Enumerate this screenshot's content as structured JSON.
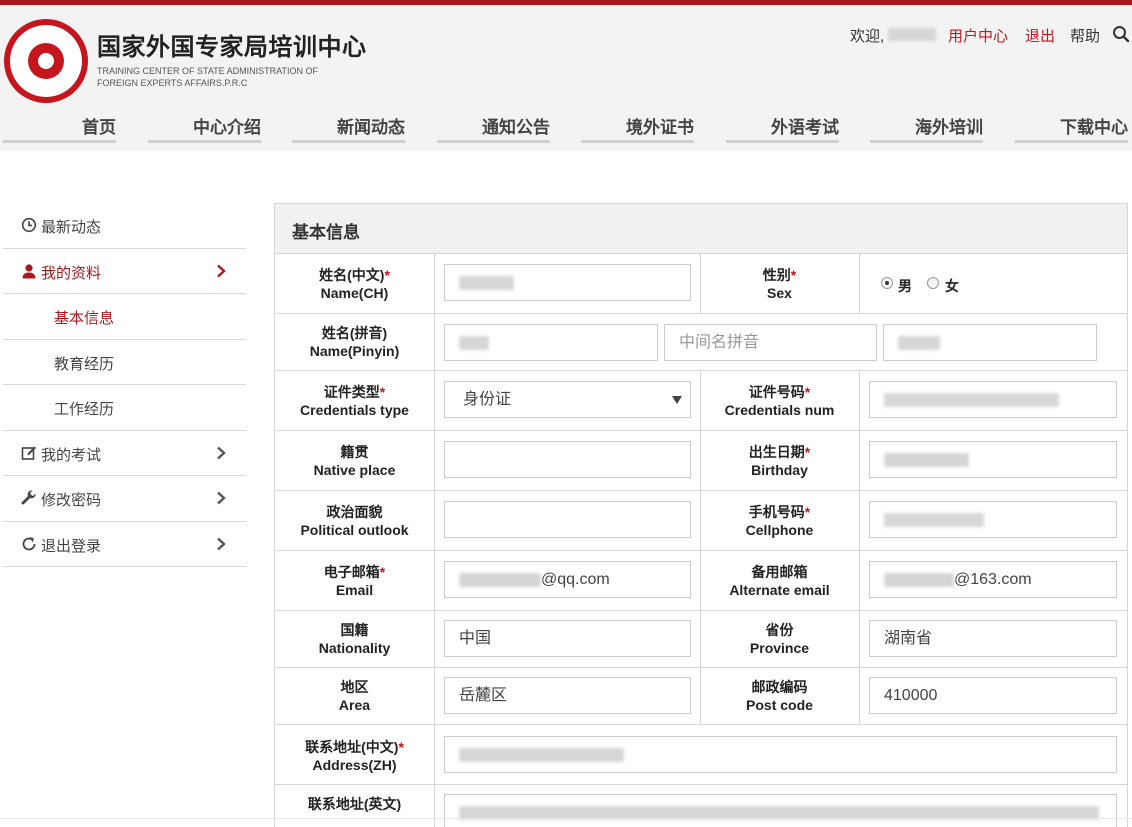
{
  "brand": {
    "logo_text": "国家外国专家局培训中心",
    "title": "国家外国专家局培训中心",
    "subtitle": "TRAINING CENTER OF STATE ADMINISTRATION OF FOREIGN EXPERTS AFFAIRS.P.R.C"
  },
  "userbar": {
    "welcome": "欢迎,",
    "user_center": "用户中心",
    "logout": "退出",
    "help": "帮助"
  },
  "nav": [
    "首页",
    "中心介绍",
    "新闻动态",
    "通知公告",
    "境外证书",
    "外语考试",
    "海外培训",
    "下载中心"
  ],
  "sidebar": {
    "items": [
      {
        "label": "最新动态",
        "icon": "clock-icon"
      },
      {
        "label": "我的资料",
        "icon": "user-icon"
      },
      {
        "label": "基本信息"
      },
      {
        "label": "教育经历"
      },
      {
        "label": "工作经历"
      },
      {
        "label": "我的考试",
        "icon": "edit-icon"
      },
      {
        "label": "修改密码",
        "icon": "wrench-icon"
      },
      {
        "label": "退出登录",
        "icon": "refresh-icon"
      }
    ]
  },
  "form": {
    "title": "基本信息",
    "name_ch": {
      "cn": "姓名(中文)",
      "en": "Name(CH)"
    },
    "sex": {
      "cn": "性别",
      "en": "Sex",
      "male": "男",
      "female": "女",
      "selected": "男"
    },
    "name_pinyin": {
      "cn": "姓名(拼音)",
      "en": "Name(Pinyin)",
      "middle_placeholder": "中间名拼音"
    },
    "cred_type": {
      "cn": "证件类型",
      "en": "Credentials type",
      "value": "身份证"
    },
    "cred_num": {
      "cn": "证件号码",
      "en": "Credentials num"
    },
    "native_place": {
      "cn": "籍贯",
      "en": "Native place"
    },
    "birthday": {
      "cn": "出生日期",
      "en": "Birthday"
    },
    "political": {
      "cn": "政治面貌",
      "en": "Political outlook"
    },
    "cellphone": {
      "cn": "手机号码",
      "en": "Cellphone"
    },
    "email": {
      "cn": "电子邮箱",
      "en": "Email",
      "domain": "@qq.com"
    },
    "alt_email": {
      "cn": "备用邮箱",
      "en": "Alternate email",
      "domain": "@163.com"
    },
    "nationality": {
      "cn": "国籍",
      "en": "Nationality",
      "value": "中国"
    },
    "province": {
      "cn": "省份",
      "en": "Province",
      "value": "湖南省"
    },
    "area": {
      "cn": "地区",
      "en": "Area",
      "value": "岳麓区"
    },
    "postcode": {
      "cn": "邮政编码",
      "en": "Post code",
      "value": "410000"
    },
    "address_zh": {
      "cn": "联系地址(中文)",
      "en": "Address(ZH)"
    },
    "address_en": {
      "cn": "联系地址(英文)"
    },
    "required_mark": "*"
  },
  "colors": {
    "accent": "#c4161c",
    "header_bg": "#f3f3f3",
    "border": "#d6d6d6"
  }
}
